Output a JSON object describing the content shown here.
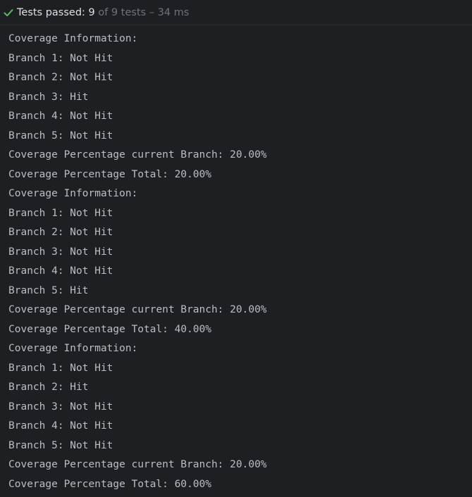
{
  "status": {
    "prefix": "Tests passed:",
    "passed": "9",
    "rest": "of 9 tests",
    "dash": "–",
    "duration": "34 ms",
    "color_ok": "#5fb865"
  },
  "console": {
    "lines": [
      "Coverage Information:",
      "Branch 1: Not Hit",
      "Branch 2: Not Hit",
      "Branch 3: Hit",
      "Branch 4: Not Hit",
      "Branch 5: Not Hit",
      "Coverage Percentage current Branch: 20.00%",
      "Coverage Percentage Total: 20.00%",
      "Coverage Information:",
      "Branch 1: Not Hit",
      "Branch 2: Not Hit",
      "Branch 3: Not Hit",
      "Branch 4: Not Hit",
      "Branch 5: Hit",
      "Coverage Percentage current Branch: 20.00%",
      "Coverage Percentage Total: 40.00%",
      "Coverage Information:",
      "Branch 1: Not Hit",
      "Branch 2: Hit",
      "Branch 3: Not Hit",
      "Branch 4: Not Hit",
      "Branch 5: Not Hit",
      "Coverage Percentage current Branch: 20.00%",
      "Coverage Percentage Total: 60.00%"
    ]
  }
}
